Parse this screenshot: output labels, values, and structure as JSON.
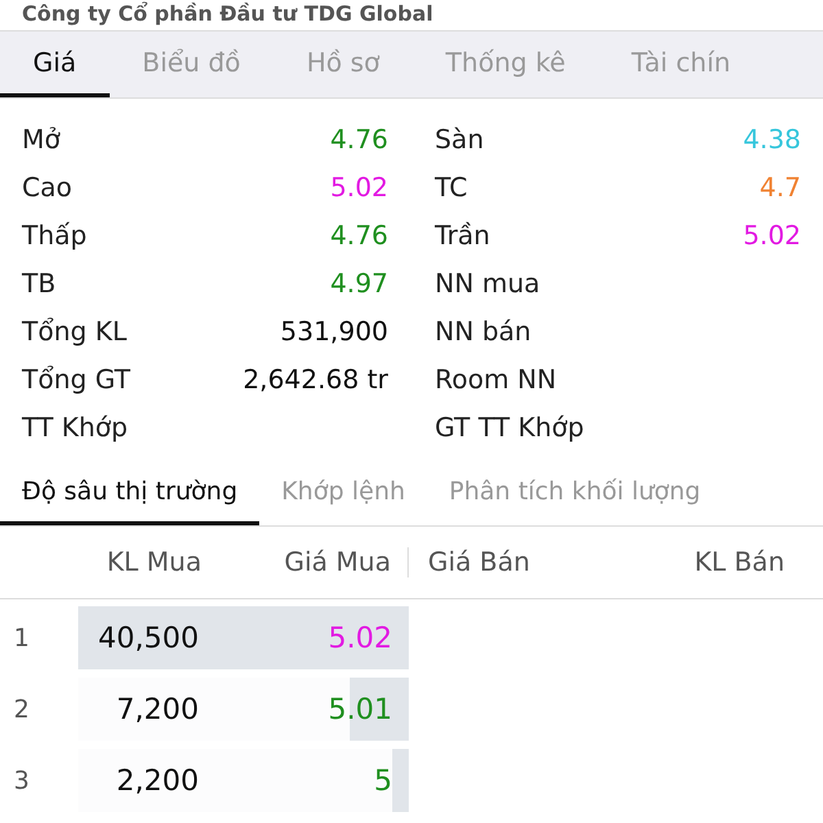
{
  "title": "Công ty Cổ phần Đầu tư TDG Global",
  "tabs": [
    {
      "label": "Giá",
      "selected": true
    },
    {
      "label": "Biểu đồ",
      "selected": false
    },
    {
      "label": "Hồ sơ",
      "selected": false
    },
    {
      "label": "Thống kê",
      "selected": false
    },
    {
      "label": "Tài chín",
      "selected": false
    }
  ],
  "stats_left": [
    {
      "label": "Mở",
      "value": "4.76",
      "color": "#1f8f1f"
    },
    {
      "label": "Cao",
      "value": "5.02",
      "color": "#e21ae2"
    },
    {
      "label": "Thấp",
      "value": "4.76",
      "color": "#1f8f1f"
    },
    {
      "label": "TB",
      "value": "4.97",
      "color": "#1f8f1f"
    },
    {
      "label": "Tổng KL",
      "value": "531,900",
      "color": "#111111"
    },
    {
      "label": "Tổng GT",
      "value": "2,642.68 tr",
      "color": "#111111"
    },
    {
      "label": "TT Khớp"
    }
  ],
  "stats_right": [
    {
      "label": "Sàn",
      "value": "4.38",
      "color": "#36c6dc"
    },
    {
      "label": "TC",
      "value": "4.7",
      "color": "#f08232"
    },
    {
      "label": "Trần",
      "value": "5.02",
      "color": "#e21ae2"
    },
    {
      "label": "NN mua"
    },
    {
      "label": "NN bán"
    },
    {
      "label": "Room NN"
    },
    {
      "label": "GT TT Khớp"
    }
  ],
  "sub_tabs": [
    {
      "label": "Độ sâu thị trường",
      "selected": true
    },
    {
      "label": "Khớp lệnh",
      "selected": false
    },
    {
      "label": "Phân tích khối lượng",
      "selected": false
    }
  ],
  "columns": [
    "KL Mua",
    "Giá Mua",
    "Giá Bán",
    "KL Bán"
  ],
  "rows": [
    {
      "index": "1",
      "volume": "40,500",
      "price": "5.02",
      "color": "#e21ae2",
      "level": 1
    },
    {
      "index": "2",
      "volume": "7,200",
      "price": "5.01",
      "color": "#1f8f1f",
      "level": 0.18
    },
    {
      "index": "3",
      "volume": "2,200",
      "price": "5",
      "color": "#1f8f1f",
      "level": 0.05
    }
  ]
}
